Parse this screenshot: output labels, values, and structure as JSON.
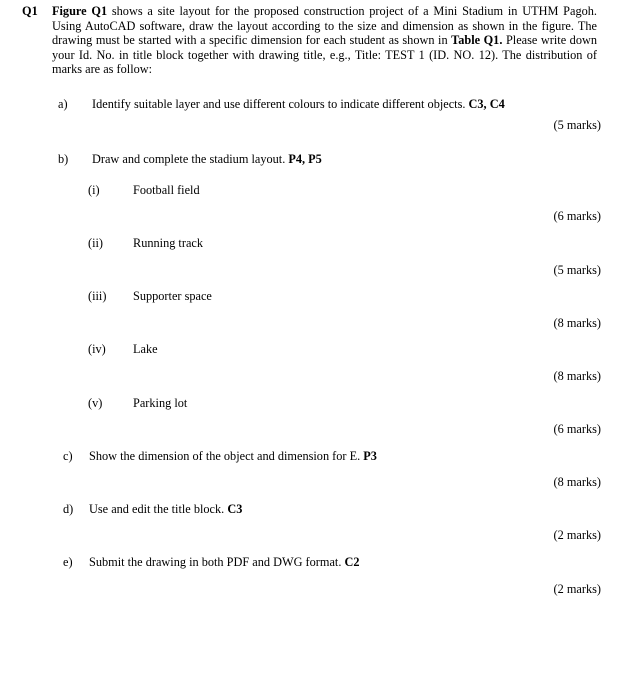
{
  "page": {
    "background_color": "#ffffff",
    "text_color": "#000000"
  },
  "question": {
    "label": "Q1",
    "stem_part1_bold": "Figure Q1",
    "stem_part2": " shows a site layout for the proposed construction project of a Mini Stadium in UTHM Pagoh. Using AutoCAD software, draw the layout according to the size and dimension as shown in the figure. The drawing must be started with a specific dimension for each student as shown in ",
    "stem_part3_bold": "Table Q1.",
    "stem_part4": " Please write down your Id. No. in title block together with drawing title, e.g., Title: TEST 1 (ID. NO. 12). The distribution of marks are as follow:"
  },
  "parts": [
    {
      "marker": "a)",
      "text": "Identify suitable layer and use different colours to indicate different objects. ",
      "text_bold": "C3, C4",
      "marks": "(5 marks)"
    },
    {
      "marker": "b)",
      "text": "Draw and complete the stadium layout. ",
      "text_bold": "P4, P5",
      "marks": ""
    },
    {
      "marker": "c)",
      "text": "Show the dimension of the object and dimension for E. ",
      "text_bold": "P3",
      "marks": "(8 marks)"
    },
    {
      "marker": "d)",
      "text": "Use and edit the title block. ",
      "text_bold": "C3",
      "marks": "(2 marks)"
    },
    {
      "marker": "e)",
      "text": "Submit the drawing in both PDF and DWG format. ",
      "text_bold": "C2",
      "marks": "(2 marks)"
    }
  ],
  "subparts": [
    {
      "marker": "(i)",
      "text": "Football field",
      "marks": "(6 marks)"
    },
    {
      "marker": "(ii)",
      "text": "Running track",
      "marks": "(5 marks)"
    },
    {
      "marker": "(iii)",
      "text": "Supporter space",
      "marks": "(8 marks)"
    },
    {
      "marker": "(iv)",
      "text": "Lake",
      "marks": "(8 marks)"
    },
    {
      "marker": "(v)",
      "text": "Parking lot",
      "marks": "(6 marks)"
    }
  ]
}
